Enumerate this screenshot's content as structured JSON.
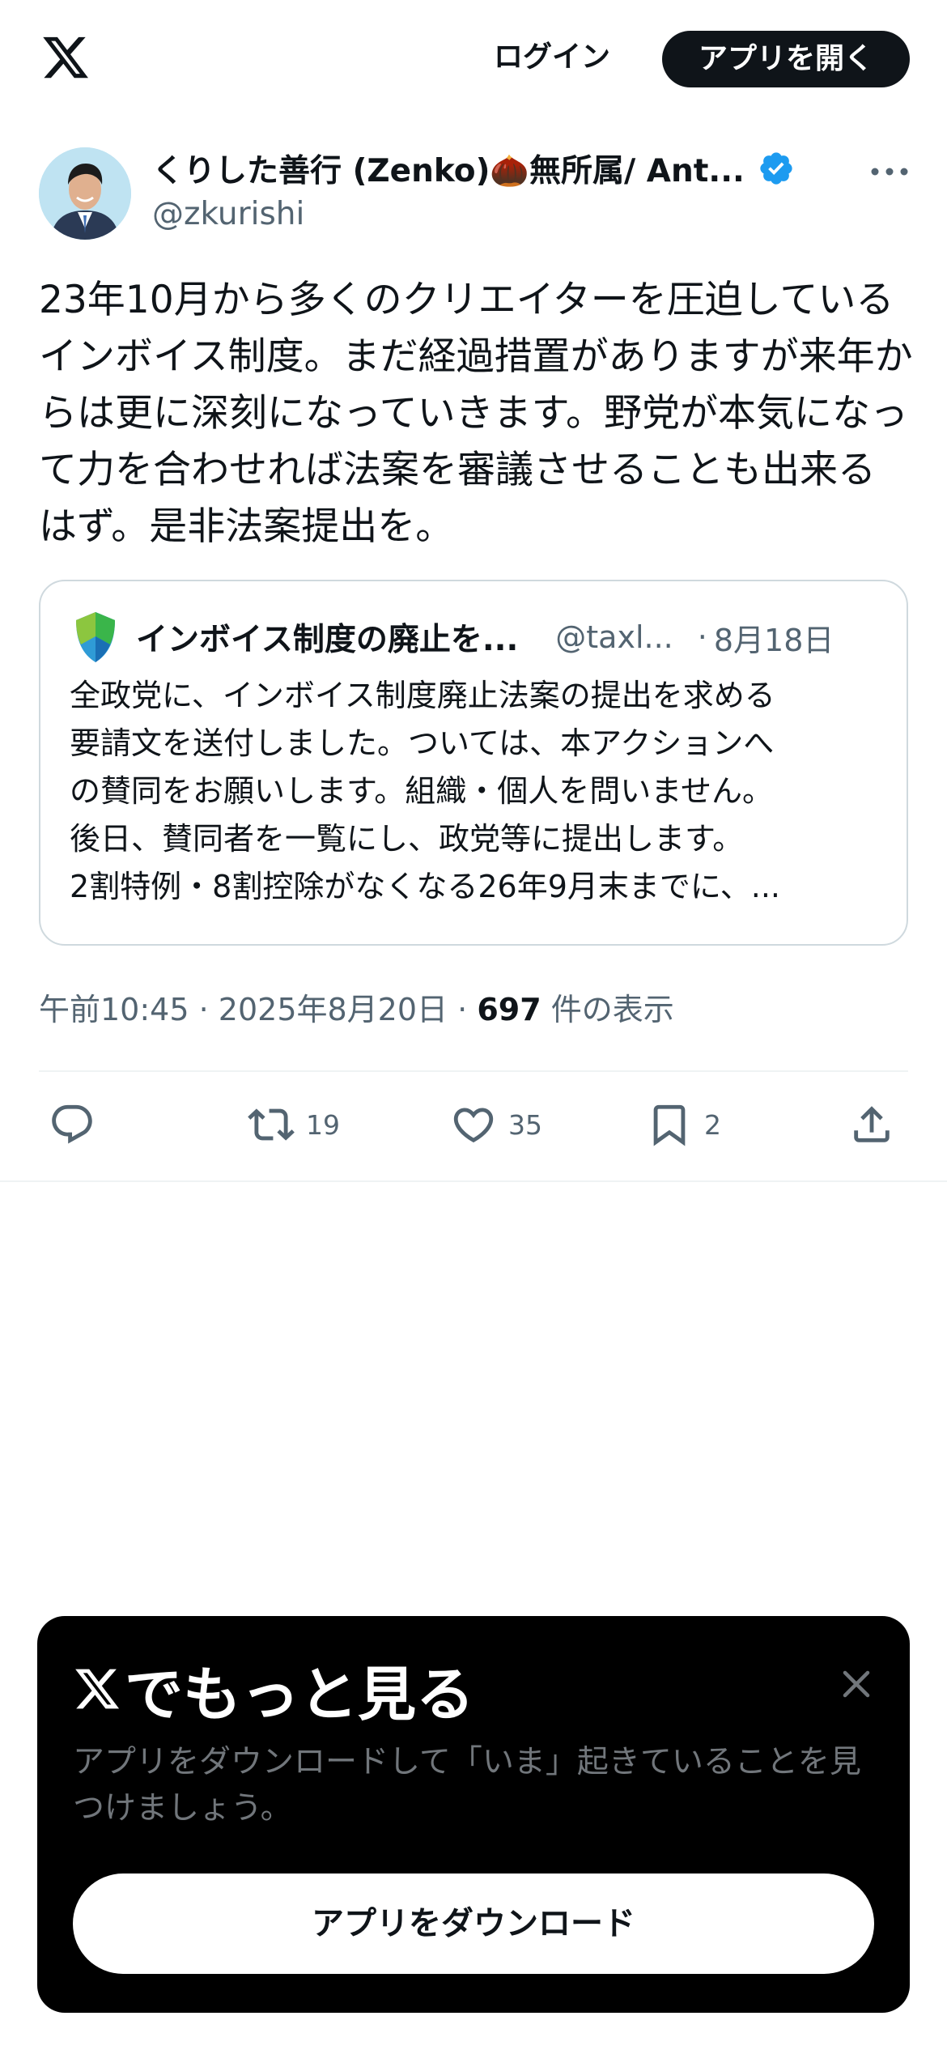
{
  "header": {
    "logo_icon": "x-logo-icon",
    "login_label": "ログイン",
    "open_app_label": "アプリを開く"
  },
  "tweet": {
    "author_name": "くりした善行 (Zenko)🌰無所属/ Ant...",
    "author_handle": "@zkurishi",
    "verified_icon": "verified-badge-icon",
    "verified_color": "#1d9bf0",
    "text": "23年10月から多くのクリエイターを圧迫しているインボイス制度。まだ経過措置がありますが来年からは更に深刻になっていきます。野党が本気になって力を合わせれば法案を審議させることも出来るはず。是非法案提出を。",
    "quote": {
      "name": "インボイス制度の廃止を...",
      "handle": "@taxl...",
      "separator": "·",
      "date": "8月18日",
      "lines": [
        "全政党に、インボイス制度廃止法案の提出を求める",
        "要請文を送付しました。ついては、本アクションへ",
        "の賛同をお願いします。組織・個人を問いません。",
        "後日、賛同者を一覧にし、政党等に提出します。",
        "2割特例・8割控除がなくなる26年9月末までに、..."
      ]
    },
    "meta": {
      "time": "午前10:45",
      "sep1": "·",
      "date": "2025年8月20日",
      "sep2": "·",
      "views_count": "697",
      "views_label": "件の表示"
    },
    "actions": {
      "reply_icon": "reply-icon",
      "retweet_icon": "retweet-icon",
      "retweet_count": "19",
      "like_icon": "heart-icon",
      "like_count": "35",
      "bookmark_icon": "bookmark-icon",
      "bookmark_count": "2",
      "share_icon": "share-icon"
    }
  },
  "promo": {
    "title": "でもっと見る",
    "description": "アプリをダウンロードして「いま」起きていることを見つけましょう。",
    "download_label": "アプリをダウンロード",
    "close_icon": "close-icon",
    "background": "#000000"
  }
}
